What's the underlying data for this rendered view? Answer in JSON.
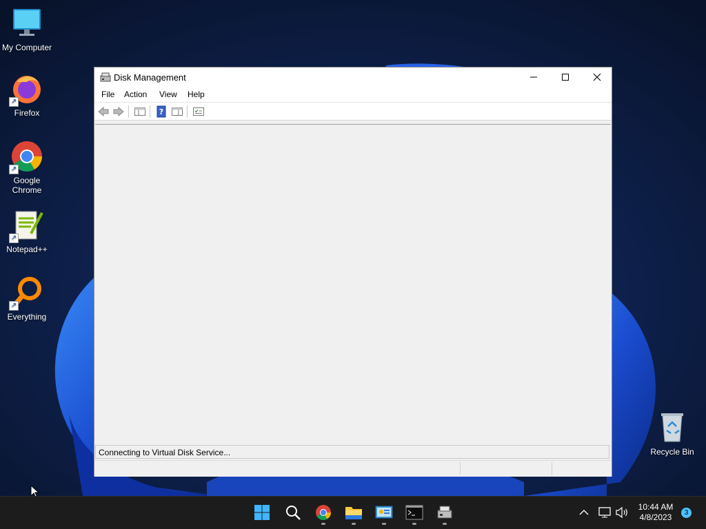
{
  "desktop": {
    "icons": [
      {
        "label": "My Computer",
        "icon": "monitor-icon"
      },
      {
        "label": "Firefox",
        "icon": "firefox-icon"
      },
      {
        "label": "Google Chrome",
        "icon": "chrome-icon"
      },
      {
        "label": "Notepad++",
        "icon": "notepadpp-icon"
      },
      {
        "label": "Everything",
        "icon": "everything-icon"
      },
      {
        "label": "Recycle Bin",
        "icon": "recycle-bin-icon"
      }
    ]
  },
  "window": {
    "title": "Disk Management",
    "menu": [
      "File",
      "Action",
      "View",
      "Help"
    ],
    "toolbar": [
      "back-arrow-icon",
      "forward-arrow-icon",
      "show-hide-console-tree-icon",
      "help-icon",
      "show-hide-action-pane-icon",
      "properties-icon"
    ],
    "status_message": "Connecting to Virtual Disk Service..."
  },
  "taskbar": {
    "apps": [
      "start-icon",
      "search-icon",
      "chrome-icon",
      "file-explorer-icon",
      "control-panel-icon",
      "terminal-icon",
      "disk-management-icon"
    ],
    "time": "10:44 AM",
    "date": "4/8/2023",
    "notification_count": "3"
  },
  "colors": {
    "accent": "#0067c0",
    "wallpaper_dark": "#0a1630",
    "wallpaper_bloom": "#1f5fe0"
  }
}
